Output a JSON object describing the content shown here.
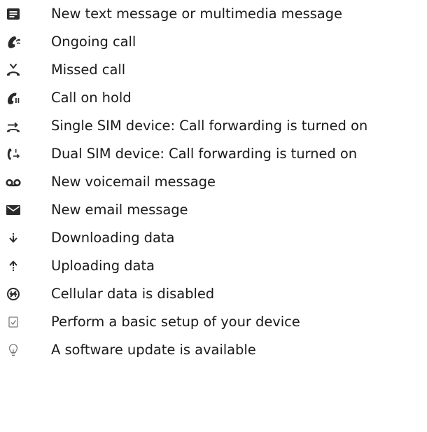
{
  "colors": {
    "text": "#1a1a1a",
    "icon": "#2b2b2b",
    "icon_light": "#7a7a7a",
    "background": "#ffffff"
  },
  "items": [
    {
      "icon": "message-icon",
      "label": "New text message or multimedia message"
    },
    {
      "icon": "ongoing-call-icon",
      "label": "Ongoing call"
    },
    {
      "icon": "missed-call-icon",
      "label": "Missed call"
    },
    {
      "icon": "call-on-hold-icon",
      "label": "Call on hold"
    },
    {
      "icon": "call-forwarding-icon",
      "label": "Single SIM device: Call forwarding is turned on"
    },
    {
      "icon": "dual-sim-call-forwarding-icon",
      "label": "Dual SIM device: Call forwarding is turned on"
    },
    {
      "icon": "voicemail-icon",
      "label": "New voicemail message"
    },
    {
      "icon": "email-icon",
      "label": "New email message"
    },
    {
      "icon": "download-icon",
      "label": "Downloading data"
    },
    {
      "icon": "upload-icon",
      "label": "Uploading data"
    },
    {
      "icon": "cellular-data-disabled-icon",
      "label": "Cellular data is disabled"
    },
    {
      "icon": "setup-checkbox-icon",
      "label": "Perform a basic setup of your device"
    },
    {
      "icon": "software-update-icon",
      "label": "A software update is available"
    }
  ]
}
